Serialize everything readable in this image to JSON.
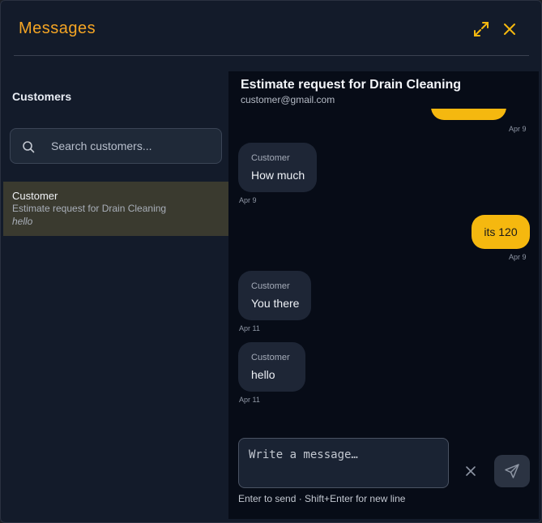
{
  "header": {
    "title": "Messages"
  },
  "sidebar": {
    "title": "Customers",
    "search_placeholder": "Search customers...",
    "conversations": [
      {
        "name": "Customer",
        "subject": "Estimate request for Drain Cleaning",
        "preview": "hello"
      }
    ]
  },
  "chat": {
    "title": "Estimate request for Drain Cleaning",
    "email": "customer@gmail.com",
    "messages": [
      {
        "direction": "out",
        "text": "",
        "time": "Apr 9"
      },
      {
        "direction": "in",
        "sender": "Customer",
        "text": "How much",
        "time": "Apr 9"
      },
      {
        "direction": "out",
        "text": "its 120",
        "time": "Apr 9"
      },
      {
        "direction": "in",
        "sender": "Customer",
        "text": "You there",
        "time": "Apr 11"
      },
      {
        "direction": "in",
        "sender": "Customer",
        "text": "hello",
        "time": "Apr 11"
      }
    ],
    "compose_placeholder": "Write a message…",
    "hint": "Enter to send · Shift+Enter for new line"
  },
  "colors": {
    "accent": "#f5a524",
    "outgoing_bubble": "#f5b80f",
    "selected_row": "#3a3a2f"
  },
  "icons": {
    "expand": "expand-icon",
    "close": "close-icon",
    "search": "search-icon",
    "clear": "x-icon",
    "send": "send-icon"
  }
}
